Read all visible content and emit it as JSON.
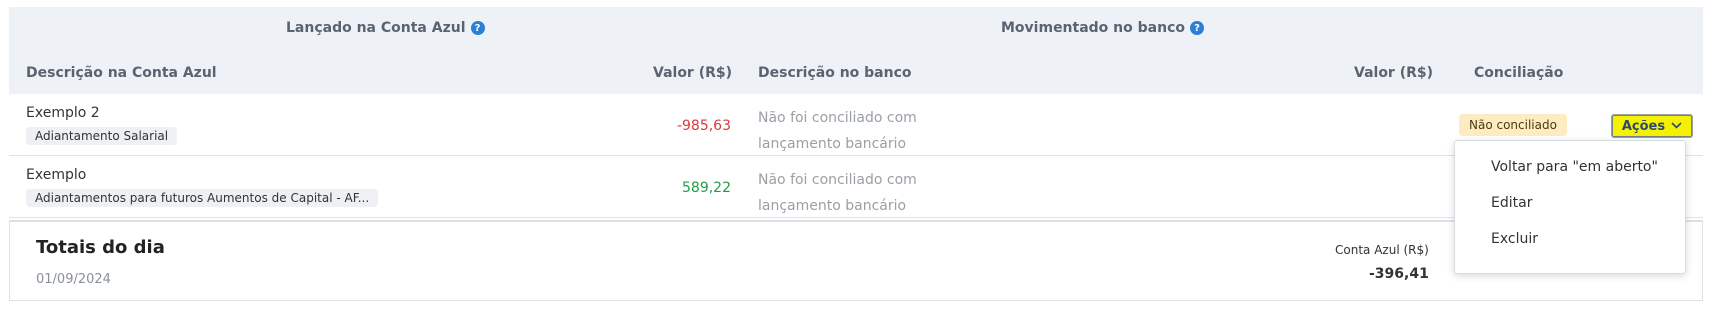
{
  "group_headers": {
    "conta_azul": "Lançado na Conta Azul",
    "banco": "Movimentado no banco",
    "help_icon_glyph": "?"
  },
  "columns": {
    "descricao_conta_azul": "Descrição na Conta Azul",
    "valor_conta_azul": "Valor (R$)",
    "descricao_banco": "Descrição no banco",
    "valor_banco": "Valor (R$)",
    "conciliacao": "Conciliação"
  },
  "rows": [
    {
      "title": "Exemplo 2",
      "category": "Adiantamento Salarial",
      "amount": "-985,63",
      "bank_description": "Não foi conciliado com lançamento bancário",
      "status": "Não conciliado",
      "actions_label": "Ações"
    },
    {
      "title": "Exemplo",
      "category": "Adiantamentos para futuros Aumentos de Capital - AF...",
      "amount": "589,22",
      "bank_description": "Não foi conciliado com lançamento bancário"
    }
  ],
  "totals": {
    "title": "Totais do dia",
    "date": "01/09/2024",
    "conta_azul_label": "Conta Azul (R$)",
    "conta_azul_value": "-396,41"
  },
  "actions_menu": {
    "items": [
      "Voltar para \"em aberto\"",
      "Editar",
      "Excluir"
    ]
  },
  "colors": {
    "negative": "#d93a3a",
    "positive": "#1e9e46",
    "actions_button": "#f4f200",
    "status_badge": "#fdebc2",
    "header_bg": "#eef2f7",
    "help_icon": "#2b7fd6"
  },
  "icons": {
    "help": "help-icon",
    "actions_chevron": "chevron-down-icon"
  }
}
